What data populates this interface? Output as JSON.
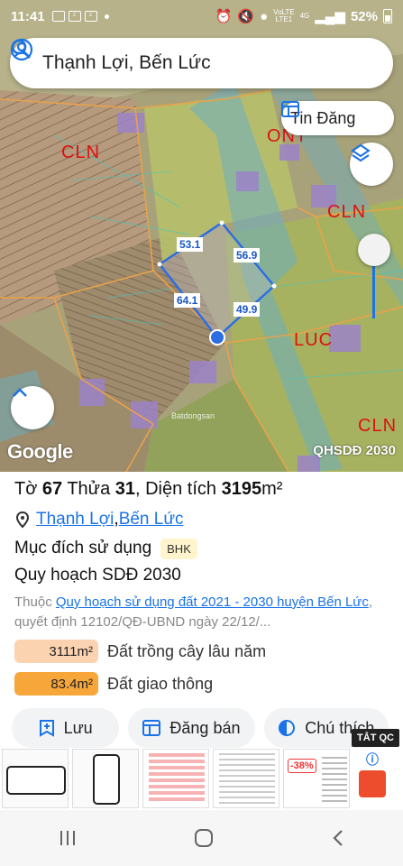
{
  "status_bar": {
    "time": "11:41",
    "network_top": "VoLTE",
    "network_type": "4G",
    "network_bottom": "LTE1",
    "battery": "52%"
  },
  "search": {
    "query": "Thạnh Lợi, Bến Lức"
  },
  "map": {
    "tin_dang_label": "Tin Đăng",
    "zone_labels": [
      "CLN",
      "ONT",
      "CLN",
      "LUC",
      "CLN"
    ],
    "dimensions": [
      "53.1",
      "56.9",
      "64.1",
      "49.9"
    ],
    "google_label": "Google",
    "plan_label": "QHSDĐ 2030",
    "watermark": "Batdongsan"
  },
  "panel": {
    "sheet_prefix": "Tờ ",
    "sheet": "67",
    "parcel_prefix": " Thửa ",
    "parcel": "31",
    "area_prefix": ", Diện tích ",
    "area": "3195",
    "area_unit": "m²",
    "location_ward": "Thạnh Lợi",
    "location_sep": ", ",
    "location_district": "Bến Lức",
    "purpose_label": "Mục đích sử dụng",
    "purpose_code": "BHK",
    "plan_title": "Quy hoạch SDĐ 2030",
    "desc_prefix": "Thuộc ",
    "desc_link": "Quy hoạch sử dụng đất 2021 - 2030 huyện Bến Lức",
    "desc_suffix": ", quyết định 12102/QĐ-UBND ngày 22/12/...",
    "zones": [
      {
        "value": "3111m²",
        "label": "Đất trồng cây lâu năm",
        "color": "#fcd3b0"
      },
      {
        "value": "83.4m²",
        "label": "Đất giao thông",
        "color": "#f7a63a"
      }
    ],
    "actions": {
      "save": "Lưu",
      "post": "Đăng bán",
      "legend": "Chú thích"
    }
  },
  "ads": {
    "badge": "TẮT QC",
    "discount": "-38%"
  }
}
